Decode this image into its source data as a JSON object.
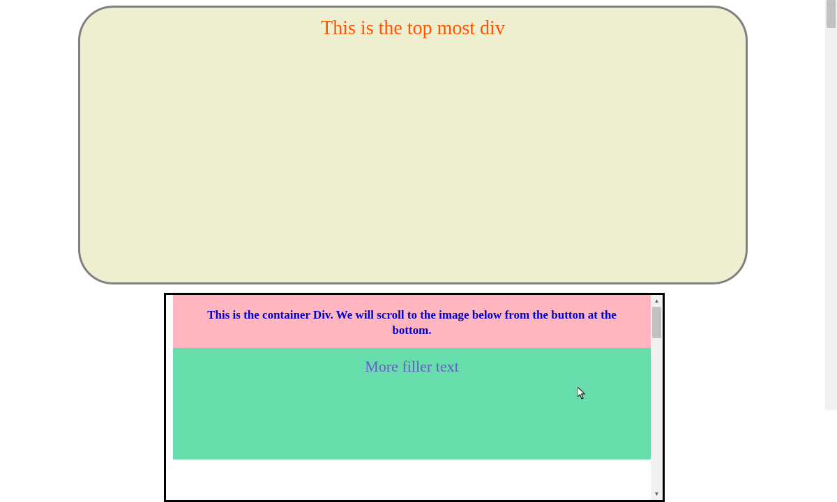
{
  "top_div": {
    "title": "This is the top most div",
    "bg_color": "#eeeed1",
    "border_color": "#808080",
    "title_color": "#ff5500"
  },
  "container_div": {
    "pink_section": {
      "text": "This is the container Div. We will scroll to the image below from the button at the bottom.",
      "bg_color": "#ffb6c1",
      "text_color": "#0000cd"
    },
    "green_section": {
      "text": "More filler text",
      "bg_color": "#66ddaa",
      "text_color": "#6a5acd"
    }
  }
}
